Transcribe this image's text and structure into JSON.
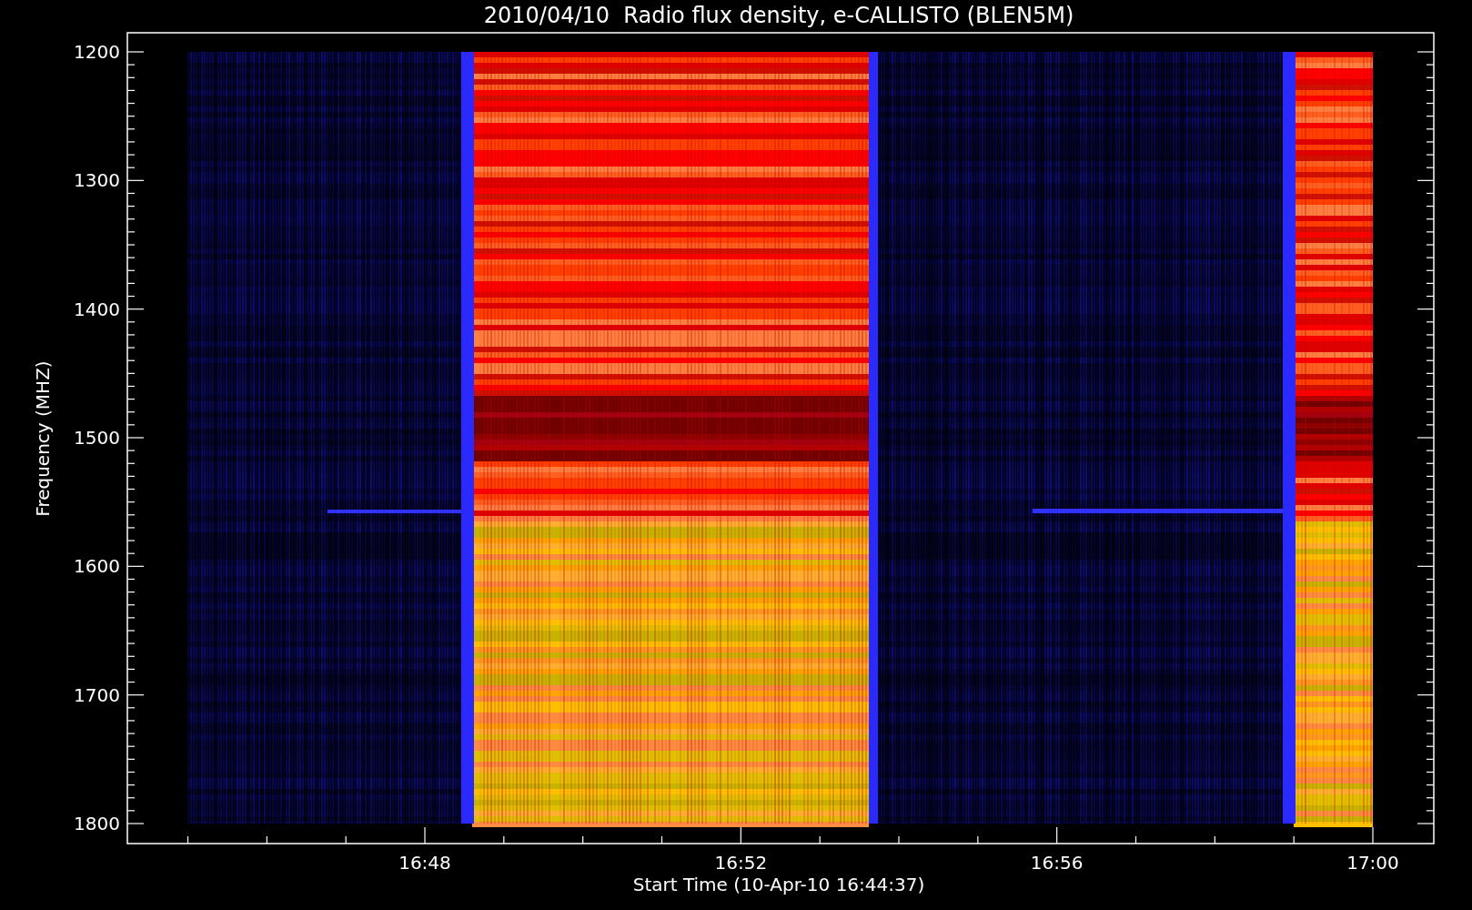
{
  "title": "2010/04/10  Radio flux density, e-CALLISTO (BLEN5M)",
  "y_axis": {
    "label": "Frequency (MHZ)",
    "ticks": [
      "1200",
      "1300",
      "1400",
      "1500",
      "1600",
      "1700",
      "1800"
    ]
  },
  "x_axis": {
    "label": "Start Time (10-Apr-10 16:44:37)",
    "ticks": [
      "16:48",
      "16:52",
      "16:56",
      "17:00"
    ]
  }
}
